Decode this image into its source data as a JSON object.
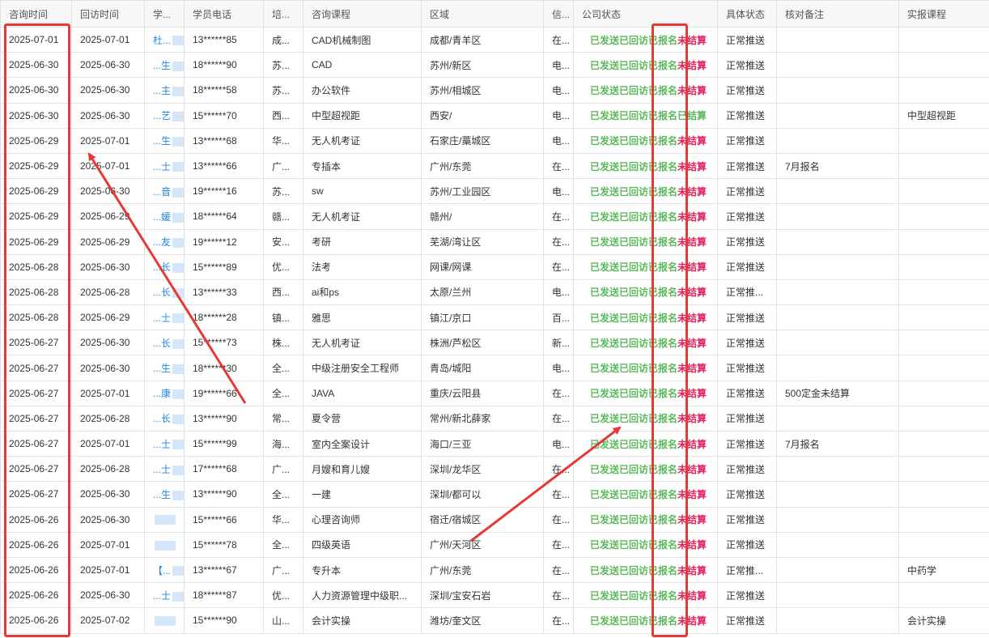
{
  "columns": [
    "咨询时间",
    "回访时间",
    "学...",
    "学员电话",
    "培...",
    "咨询课程",
    "区域",
    "信...",
    "公司状态",
    "具体状态",
    "核对备注",
    "实报课程"
  ],
  "status_labels": {
    "sent": "已发送",
    "visited": "已回访",
    "enrolled": "已报名",
    "unsettled": "未结算",
    "settled": "已结算"
  },
  "rows": [
    {
      "consult": "2025-07-01",
      "visit": "2025-07-01",
      "name": "杜...",
      "phone": "13******85",
      "train": "成...",
      "course": "CAD机械制图",
      "area": "成都/青羊区",
      "info": "在...",
      "settle": "unsettled",
      "detail": "正常推送",
      "note": "",
      "actual": ""
    },
    {
      "consult": "2025-06-30",
      "visit": "2025-06-30",
      "name": "...生",
      "phone": "18******90",
      "train": "苏...",
      "course": "CAD",
      "area": "苏州/新区",
      "info": "电...",
      "settle": "unsettled",
      "detail": "正常推送",
      "note": "",
      "actual": ""
    },
    {
      "consult": "2025-06-30",
      "visit": "2025-06-30",
      "name": "...主",
      "phone": "18******58",
      "train": "苏...",
      "course": "办公软件",
      "area": "苏州/相城区",
      "info": "电...",
      "settle": "unsettled",
      "detail": "正常推送",
      "note": "",
      "actual": ""
    },
    {
      "consult": "2025-06-30",
      "visit": "2025-06-30",
      "name": "...艺",
      "phone": "15******70",
      "train": "西...",
      "course": "中型超视距",
      "area": "西安/",
      "info": "电...",
      "settle": "settled",
      "detail": "正常推送",
      "note": "",
      "actual": "中型超视距"
    },
    {
      "consult": "2025-06-29",
      "visit": "2025-07-01",
      "name": "...生",
      "phone": "13******68",
      "train": "华...",
      "course": "无人机考证",
      "area": "石家庄/藁城区",
      "info": "电...",
      "settle": "unsettled",
      "detail": "正常推送",
      "note": "",
      "actual": ""
    },
    {
      "consult": "2025-06-29",
      "visit": "2025-07-01",
      "name": "...士",
      "phone": "13******66",
      "train": "广...",
      "course": "专插本",
      "area": "广州/东莞",
      "info": "在...",
      "settle": "unsettled",
      "detail": "正常推送",
      "note": "7月报名",
      "actual": ""
    },
    {
      "consult": "2025-06-29",
      "visit": "2025-06-30",
      "name": "...音",
      "phone": "19******16",
      "train": "苏...",
      "course": "sw",
      "area": "苏州/工业园区",
      "info": "电...",
      "settle": "unsettled",
      "detail": "正常推送",
      "note": "",
      "actual": ""
    },
    {
      "consult": "2025-06-29",
      "visit": "2025-06-29",
      "name": "...媛",
      "phone": "18******64",
      "train": "赣...",
      "course": "无人机考证",
      "area": "赣州/",
      "info": "在...",
      "settle": "unsettled",
      "detail": "正常推送",
      "note": "",
      "actual": ""
    },
    {
      "consult": "2025-06-29",
      "visit": "2025-06-29",
      "name": "...友",
      "phone": "19******12",
      "train": "安...",
      "course": "考研",
      "area": "芜湖/湾让区",
      "info": "在...",
      "settle": "unsettled",
      "detail": "正常推送",
      "note": "",
      "actual": ""
    },
    {
      "consult": "2025-06-28",
      "visit": "2025-06-30",
      "name": "...长",
      "phone": "15******89",
      "train": "优...",
      "course": "法考",
      "area": "网课/网课",
      "info": "在...",
      "settle": "unsettled",
      "detail": "正常推送",
      "note": "",
      "actual": ""
    },
    {
      "consult": "2025-06-28",
      "visit": "2025-06-28",
      "name": "...长",
      "phone": "13******33",
      "train": "西...",
      "course": "ai和ps",
      "area": "太原/兰州",
      "info": "电...",
      "settle": "unsettled",
      "detail": "正常推...",
      "note": "",
      "actual": ""
    },
    {
      "consult": "2025-06-28",
      "visit": "2025-06-29",
      "name": "...士",
      "phone": "18******28",
      "train": "镇...",
      "course": "雅思",
      "area": "镇江/京口",
      "info": "百...",
      "settle": "unsettled",
      "detail": "正常推送",
      "note": "",
      "actual": ""
    },
    {
      "consult": "2025-06-27",
      "visit": "2025-06-30",
      "name": "...长",
      "phone": "15******73",
      "train": "株...",
      "course": "无人机考证",
      "area": "株洲/芦松区",
      "info": "新...",
      "settle": "unsettled",
      "detail": "正常推送",
      "note": "",
      "actual": ""
    },
    {
      "consult": "2025-06-27",
      "visit": "2025-06-30",
      "name": "...生",
      "phone": "18******30",
      "train": "全...",
      "course": "中级注册安全工程师",
      "area": "青岛/城阳",
      "info": "电...",
      "settle": "unsettled",
      "detail": "正常推送",
      "note": "",
      "actual": ""
    },
    {
      "consult": "2025-06-27",
      "visit": "2025-07-01",
      "name": "...康",
      "phone": "19******66",
      "train": "全...",
      "course": "JAVA",
      "area": "重庆/云阳县",
      "info": "在...",
      "settle": "unsettled",
      "detail": "正常推送",
      "note": "500定金未结算",
      "actual": ""
    },
    {
      "consult": "2025-06-27",
      "visit": "2025-06-28",
      "name": "...长",
      "phone": "13******90",
      "train": "常...",
      "course": "夏令营",
      "area": "常州/新北薛家",
      "info": "在...",
      "settle": "unsettled",
      "detail": "正常推送",
      "note": "",
      "actual": ""
    },
    {
      "consult": "2025-06-27",
      "visit": "2025-07-01",
      "name": "...士",
      "phone": "15******99",
      "train": "海...",
      "course": "室内全案设计",
      "area": "海口/三亚",
      "info": "电...",
      "settle": "unsettled",
      "detail": "正常推送",
      "note": "7月报名",
      "actual": ""
    },
    {
      "consult": "2025-06-27",
      "visit": "2025-06-28",
      "name": "...士",
      "phone": "17******68",
      "train": "广...",
      "course": "月嫂和育儿嫂",
      "area": "深圳/龙华区",
      "info": "在...",
      "settle": "unsettled",
      "detail": "正常推送",
      "note": "",
      "actual": ""
    },
    {
      "consult": "2025-06-27",
      "visit": "2025-06-30",
      "name": "...生",
      "phone": "13******90",
      "train": "全...",
      "course": "一建",
      "area": "深圳/都可以",
      "info": "在...",
      "settle": "unsettled",
      "detail": "正常推送",
      "note": "",
      "actual": ""
    },
    {
      "consult": "2025-06-26",
      "visit": "2025-06-30",
      "name": "",
      "phone": "15******66",
      "train": "华...",
      "course": "心理咨询师",
      "area": "宿迁/宿城区",
      "info": "在...",
      "settle": "unsettled",
      "detail": "正常推送",
      "note": "",
      "actual": ""
    },
    {
      "consult": "2025-06-26",
      "visit": "2025-07-01",
      "name": "",
      "phone": "15******78",
      "train": "全...",
      "course": "四级英语",
      "area": "广州/天河区",
      "info": "在...",
      "settle": "unsettled",
      "detail": "正常推送",
      "note": "",
      "actual": ""
    },
    {
      "consult": "2025-06-26",
      "visit": "2025-07-01",
      "name": "【...",
      "phone": "13******67",
      "train": "广...",
      "course": "专升本",
      "area": "广州/东莞",
      "info": "在...",
      "settle": "unsettled",
      "detail": "正常推...",
      "note": "",
      "actual": "中药学"
    },
    {
      "consult": "2025-06-26",
      "visit": "2025-06-30",
      "name": "...士",
      "phone": "18******87",
      "train": "优...",
      "course": "人力资源管理中级职...",
      "area": "深圳/宝安石岩",
      "info": "在...",
      "settle": "unsettled",
      "detail": "正常推送",
      "note": "",
      "actual": ""
    },
    {
      "consult": "2025-06-26",
      "visit": "2025-07-02",
      "name": "",
      "phone": "15******90",
      "train": "山...",
      "course": "会计实操",
      "area": "潍坊/奎文区",
      "info": "在...",
      "settle": "unsettled",
      "detail": "正常推送",
      "note": "",
      "actual": "会计实操"
    }
  ],
  "colors": {
    "annotation": "#e53935",
    "status_green": "#5cb85c",
    "status_red": "#e0245e",
    "link": "#1e88e5"
  }
}
